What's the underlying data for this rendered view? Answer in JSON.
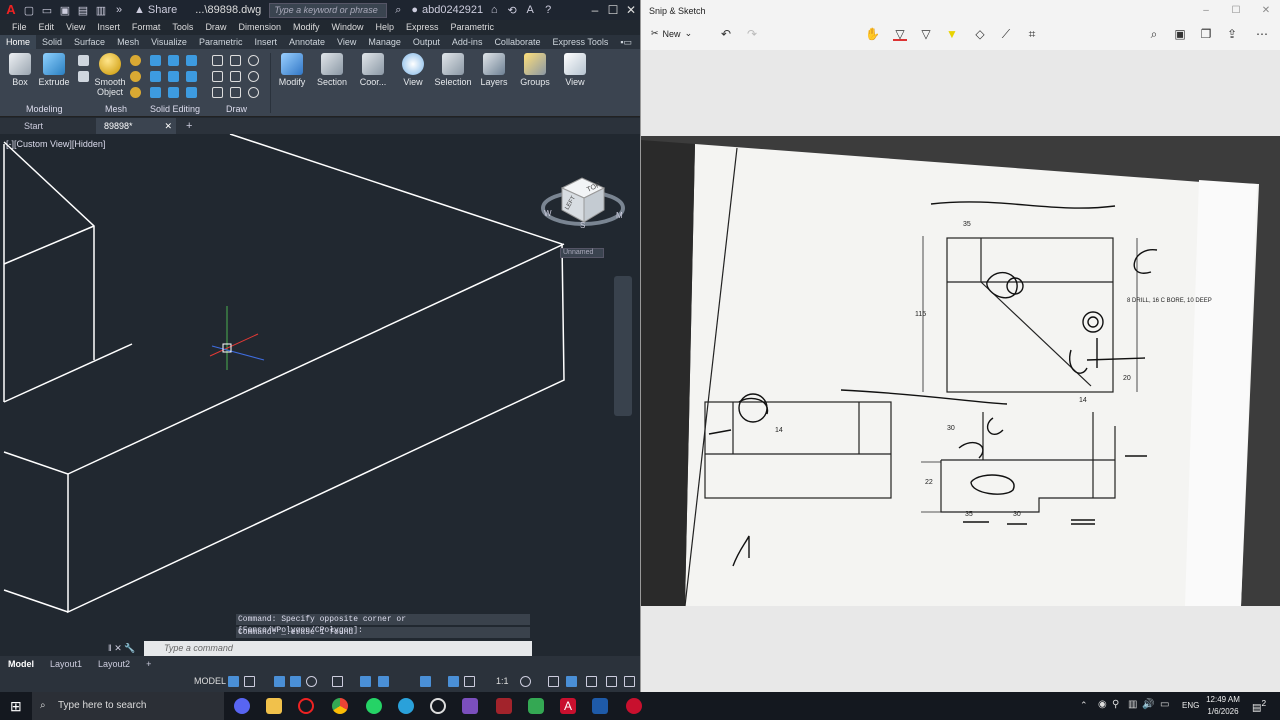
{
  "autocad": {
    "share_label": "Share",
    "filename": "...\\89898.dwg",
    "search_placeholder": "Type a keyword or phrase",
    "username": "abd0242921",
    "menu": [
      "File",
      "Edit",
      "View",
      "Insert",
      "Format",
      "Tools",
      "Draw",
      "Dimension",
      "Modify",
      "Window",
      "Help",
      "Express",
      "Parametric"
    ],
    "ribbon_tabs": [
      "Home",
      "Solid",
      "Surface",
      "Mesh",
      "Visualize",
      "Parametric",
      "Insert",
      "Annotate",
      "View",
      "Manage",
      "Output",
      "Add-ins",
      "Collaborate",
      "Express Tools"
    ],
    "active_ribbon_tab": "Home",
    "ribbon_buttons": {
      "box": "Box",
      "extrude": "Extrude",
      "smooth_object": "Smooth Object",
      "modify": "Modify",
      "section": "Section",
      "coordinates": "Coor...",
      "view": "View",
      "selection": "Selection",
      "layers": "Layers",
      "groups": "Groups",
      "view2": "View"
    },
    "panel_titles": {
      "modeling": "Modeling",
      "mesh": "Mesh",
      "solid_editing": "Solid Editing",
      "draw": "Draw"
    },
    "doc_tabs": {
      "start": "Start",
      "active": "89898*"
    },
    "viewport_label": "[-][Custom View][Hidden]",
    "viewcube": {
      "top": "TOP",
      "left": "LEFT",
      "front": "FRONT",
      "compass_w": "W",
      "compass_s": "S",
      "compass_m": "M",
      "wcs": "Unnamed"
    },
    "command_history": [
      "Command: Specify opposite corner or [Fence/WPolygon/CPolygon]:",
      "Command: _.erase 1 found"
    ],
    "command_placeholder": "Type a command",
    "layout_tabs": [
      "Model",
      "Layout1",
      "Layout2"
    ],
    "status_model": "MODEL",
    "status_scale": "1:1"
  },
  "snip": {
    "title": "Snip & Sketch",
    "new_label": "New",
    "drawing_dims": {
      "d1": "35",
      "d2": "115",
      "d3": "20",
      "d4": "14",
      "d5": "30",
      "d6": "22",
      "d7": "35",
      "d8": "30",
      "d9": "14",
      "note": "8 DRILL, 16 C BORE, 10 DEEP"
    }
  },
  "taskbar": {
    "search_placeholder": "Type here to search",
    "time": "12:49 AM",
    "date": "1/6/2026",
    "lang": "ENG",
    "notification_count": "2"
  }
}
